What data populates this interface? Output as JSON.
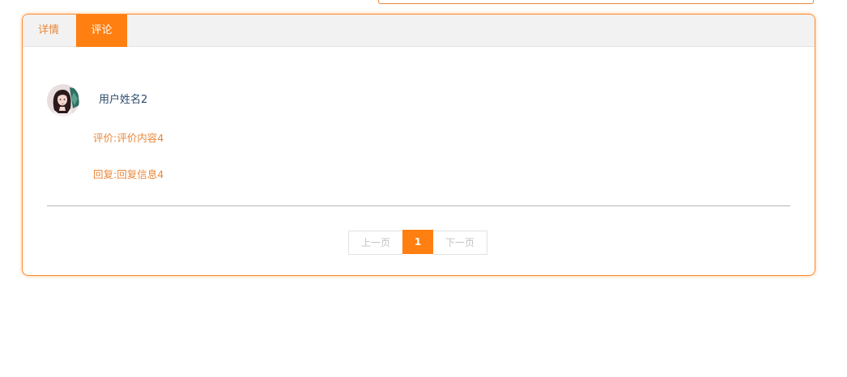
{
  "tabs": {
    "details_label": "详情",
    "comments_label": "评论"
  },
  "comment": {
    "user_name": "用户姓名2",
    "evaluation": "评价:评价内容4",
    "reply": "回复:回复信息4"
  },
  "pagination": {
    "prev_label": "上一页",
    "current_page": "1",
    "next_label": "下一页"
  },
  "colors": {
    "accent": "#ff7f11",
    "text_orange": "#e8873a",
    "name_blue": "#2b4a6b"
  }
}
